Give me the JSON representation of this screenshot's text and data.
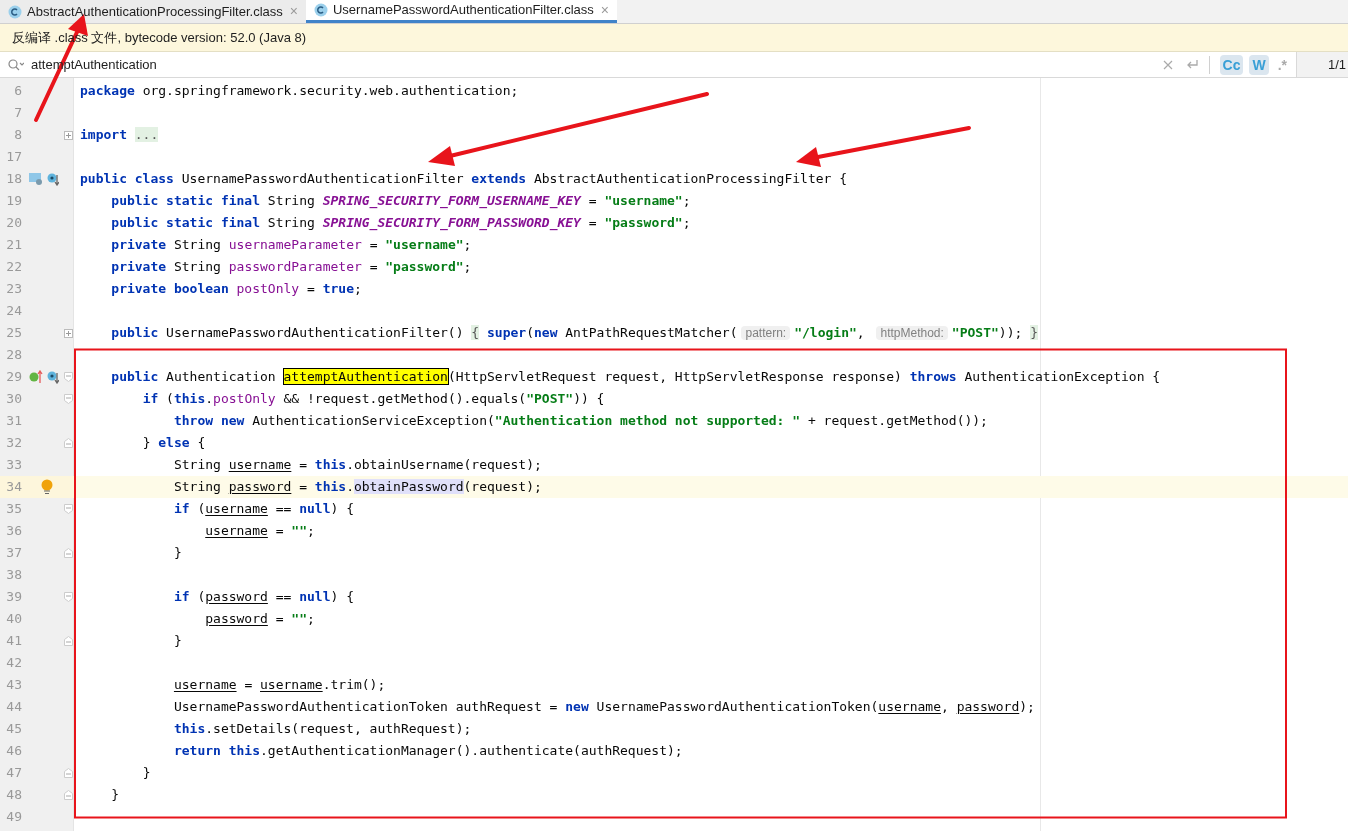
{
  "tabs": [
    {
      "label": "AbstractAuthenticationProcessingFilter.class",
      "close": "×",
      "selected": false
    },
    {
      "label": "UsernamePasswordAuthenticationFilter.class",
      "close": "×",
      "selected": true
    }
  ],
  "banner": {
    "text": "反编译 .class 文件, bytecode version: 52.0 (Java 8)"
  },
  "search": {
    "value": "attemptAuthentication",
    "options": [
      {
        "label": "Cc",
        "on": true
      },
      {
        "label": "W",
        "on": true
      },
      {
        "label": ".*",
        "on": false
      }
    ],
    "count": "1/1"
  },
  "editor": {
    "lines": [
      {
        "number": "6",
        "current": false,
        "tokens": [
          {
            "kind": "kw",
            "text": "package"
          },
          {
            "kind": "text",
            "text": " org.springframework.security.web.authentication;"
          }
        ]
      },
      {
        "number": "7",
        "current": false
      },
      {
        "number": "8",
        "current": false,
        "fold_marker": {
          "kind": "expand"
        },
        "tokens": [
          {
            "kind": "kw",
            "text": "import "
          },
          {
            "kind": "folded",
            "text": "..."
          }
        ]
      },
      {
        "number": "17",
        "current": false
      },
      {
        "number": "18",
        "current": false,
        "gutter": [
          {
            "kind": "implemented"
          },
          {
            "kind": "overridden"
          }
        ],
        "tokens": [
          {
            "kind": "kw",
            "text": "public class"
          },
          {
            "kind": "text",
            "text": " UsernamePasswordAuthenticationFilter "
          },
          {
            "kind": "kw",
            "text": "extends"
          },
          {
            "kind": "text",
            "text": " AbstractAuthenticationProcessingFilter {"
          }
        ]
      },
      {
        "number": "19",
        "current": false,
        "tokens": [
          {
            "kind": "kw",
            "text": "    public static final"
          },
          {
            "kind": "text",
            "text": " String "
          },
          {
            "kind": "const",
            "text": "SPRING_SECURITY_FORM_USERNAME_KEY"
          },
          {
            "kind": "text",
            "text": " = "
          },
          {
            "kind": "str",
            "text": "\"username\""
          },
          {
            "kind": "text",
            "text": ";"
          }
        ]
      },
      {
        "number": "20",
        "current": false,
        "tokens": [
          {
            "kind": "kw",
            "text": "    public static final"
          },
          {
            "kind": "text",
            "text": " String "
          },
          {
            "kind": "const",
            "text": "SPRING_SECURITY_FORM_PASSWORD_KEY"
          },
          {
            "kind": "text",
            "text": " = "
          },
          {
            "kind": "str",
            "text": "\"password\""
          },
          {
            "kind": "text",
            "text": ";"
          }
        ]
      },
      {
        "number": "21",
        "current": false,
        "tokens": [
          {
            "kind": "kw",
            "text": "    private"
          },
          {
            "kind": "text",
            "text": " String "
          },
          {
            "kind": "field",
            "text": "usernameParameter"
          },
          {
            "kind": "text",
            "text": " = "
          },
          {
            "kind": "str",
            "text": "\"username\""
          },
          {
            "kind": "text",
            "text": ";"
          }
        ]
      },
      {
        "number": "22",
        "current": false,
        "tokens": [
          {
            "kind": "kw",
            "text": "    private"
          },
          {
            "kind": "text",
            "text": " String "
          },
          {
            "kind": "field",
            "text": "passwordParameter"
          },
          {
            "kind": "text",
            "text": " = "
          },
          {
            "kind": "str",
            "text": "\"password\""
          },
          {
            "kind": "text",
            "text": ";"
          }
        ]
      },
      {
        "number": "23",
        "current": false,
        "tokens": [
          {
            "kind": "kw",
            "text": "    private boolean "
          },
          {
            "kind": "field",
            "text": "postOnly"
          },
          {
            "kind": "text",
            "text": " = "
          },
          {
            "kind": "kw",
            "text": "true"
          },
          {
            "kind": "text",
            "text": ";"
          }
        ]
      },
      {
        "number": "24",
        "current": false
      },
      {
        "number": "25",
        "current": false,
        "fold_marker": {
          "kind": "expand"
        },
        "tokens": [
          {
            "kind": "kw",
            "text": "    public"
          },
          {
            "kind": "text",
            "text": " UsernamePasswordAuthenticationFilter() "
          },
          {
            "kind": "folded",
            "text": "{"
          },
          {
            "kind": "kw",
            "text": " super"
          },
          {
            "kind": "text",
            "text": "("
          },
          {
            "kind": "kw",
            "text": "new"
          },
          {
            "kind": "text",
            "text": " AntPathRequestMatcher("
          },
          {
            "kind": "hint",
            "text": "pattern:"
          },
          {
            "kind": "str",
            "text": "\"/login\""
          },
          {
            "kind": "text",
            "text": ", "
          },
          {
            "kind": "hint",
            "text": "httpMethod:"
          },
          {
            "kind": "str",
            "text": "\"POST\""
          },
          {
            "kind": "text",
            "text": ")); "
          },
          {
            "kind": "folded",
            "text": "}"
          }
        ]
      },
      {
        "number": "28",
        "current": false
      },
      {
        "number": "29",
        "current": false,
        "gutter": [
          {
            "kind": "implements"
          },
          {
            "kind": "overridden"
          }
        ],
        "fold_marker": {
          "kind": "start"
        },
        "tokens": [
          {
            "kind": "kw",
            "text": "    public"
          },
          {
            "kind": "text",
            "text": " Authentication "
          },
          {
            "kind": "match",
            "text": "attemptAuthentication"
          },
          {
            "kind": "text",
            "text": "(HttpServletRequest request, HttpServletResponse response) "
          },
          {
            "kind": "kw",
            "text": "throws"
          },
          {
            "kind": "text",
            "text": " AuthenticationException {"
          }
        ]
      },
      {
        "number": "30",
        "current": false,
        "fold_marker": {
          "kind": "start"
        },
        "tokens": [
          {
            "kind": "kw",
            "text": "        if"
          },
          {
            "kind": "text",
            "text": " ("
          },
          {
            "kind": "kw",
            "text": "this"
          },
          {
            "kind": "text",
            "text": "."
          },
          {
            "kind": "field",
            "text": "postOnly"
          },
          {
            "kind": "text",
            "text": " && !request.getMethod().equals("
          },
          {
            "kind": "str",
            "text": "\"POST\""
          },
          {
            "kind": "text",
            "text": ")) {"
          }
        ]
      },
      {
        "number": "31",
        "current": false,
        "tokens": [
          {
            "kind": "kw",
            "text": "            throw new"
          },
          {
            "kind": "text",
            "text": " AuthenticationServiceException("
          },
          {
            "kind": "str",
            "text": "\"Authentication method not supported: \""
          },
          {
            "kind": "text",
            "text": " + request.getMethod());"
          }
        ]
      },
      {
        "number": "32",
        "current": false,
        "fold_marker": {
          "kind": "end"
        },
        "tokens": [
          {
            "kind": "text",
            "text": "        } "
          },
          {
            "kind": "kw",
            "text": "else"
          },
          {
            "kind": "text",
            "text": " {"
          }
        ]
      },
      {
        "number": "33",
        "current": false,
        "tokens": [
          {
            "kind": "text",
            "text": "            String "
          },
          {
            "kind": "var",
            "text": "username"
          },
          {
            "kind": "text",
            "text": " = "
          },
          {
            "kind": "kw",
            "text": "this"
          },
          {
            "kind": "text",
            "text": ".obtainUsername(request);"
          }
        ]
      },
      {
        "number": "34",
        "current": true,
        "gutter": [
          {
            "kind": "bulb"
          }
        ],
        "tokens": [
          {
            "kind": "text",
            "text": "            String "
          },
          {
            "kind": "var",
            "text": "password"
          },
          {
            "kind": "text",
            "text": " = "
          },
          {
            "kind": "kw",
            "text": "this"
          },
          {
            "kind": "text",
            "text": "."
          },
          {
            "kind": "usage",
            "text": "obtainPassword"
          },
          {
            "kind": "text",
            "text": "(request);"
          }
        ]
      },
      {
        "number": "35",
        "current": false,
        "fold_marker": {
          "kind": "start"
        },
        "tokens": [
          {
            "kind": "kw",
            "text": "            if"
          },
          {
            "kind": "text",
            "text": " ("
          },
          {
            "kind": "var",
            "text": "username"
          },
          {
            "kind": "text",
            "text": " == "
          },
          {
            "kind": "kw",
            "text": "null"
          },
          {
            "kind": "text",
            "text": ") {"
          }
        ]
      },
      {
        "number": "36",
        "current": false,
        "tokens": [
          {
            "kind": "var",
            "text": "                username"
          },
          {
            "kind": "text",
            "text": " = "
          },
          {
            "kind": "str",
            "text": "\"\""
          },
          {
            "kind": "text",
            "text": ";"
          }
        ]
      },
      {
        "number": "37",
        "current": false,
        "fold_marker": {
          "kind": "end"
        },
        "tokens": [
          {
            "kind": "text",
            "text": "            }"
          }
        ]
      },
      {
        "number": "38",
        "current": false
      },
      {
        "number": "39",
        "current": false,
        "fold_marker": {
          "kind": "start"
        },
        "tokens": [
          {
            "kind": "kw",
            "text": "            if"
          },
          {
            "kind": "text",
            "text": " ("
          },
          {
            "kind": "var",
            "text": "password"
          },
          {
            "kind": "text",
            "text": " == "
          },
          {
            "kind": "kw",
            "text": "null"
          },
          {
            "kind": "text",
            "text": ") {"
          }
        ]
      },
      {
        "number": "40",
        "current": false,
        "tokens": [
          {
            "kind": "var",
            "text": "                password"
          },
          {
            "kind": "text",
            "text": " = "
          },
          {
            "kind": "str",
            "text": "\"\""
          },
          {
            "kind": "text",
            "text": ";"
          }
        ]
      },
      {
        "number": "41",
        "current": false,
        "fold_marker": {
          "kind": "end"
        },
        "tokens": [
          {
            "kind": "text",
            "text": "            }"
          }
        ]
      },
      {
        "number": "42",
        "current": false
      },
      {
        "number": "43",
        "current": false,
        "tokens": [
          {
            "kind": "var",
            "text": "            username"
          },
          {
            "kind": "text",
            "text": " = "
          },
          {
            "kind": "var",
            "text": "username"
          },
          {
            "kind": "text",
            "text": ".trim();"
          }
        ]
      },
      {
        "number": "44",
        "current": false,
        "tokens": [
          {
            "kind": "text",
            "text": "            UsernamePasswordAuthenticationToken authRequest = "
          },
          {
            "kind": "kw",
            "text": "new"
          },
          {
            "kind": "text",
            "text": " UsernamePasswordAuthenticationToken("
          },
          {
            "kind": "var",
            "text": "username"
          },
          {
            "kind": "text",
            "text": ", "
          },
          {
            "kind": "var",
            "text": "password"
          },
          {
            "kind": "text",
            "text": ");"
          }
        ]
      },
      {
        "number": "45",
        "current": false,
        "tokens": [
          {
            "kind": "kw",
            "text": "            this"
          },
          {
            "kind": "text",
            "text": ".setDetails(request, authRequest);"
          }
        ]
      },
      {
        "number": "46",
        "current": false,
        "tokens": [
          {
            "kind": "kw",
            "text": "            return this"
          },
          {
            "kind": "text",
            "text": ".getAuthenticationManager().authenticate(authRequest);"
          }
        ]
      },
      {
        "number": "47",
        "current": false,
        "fold_marker": {
          "kind": "end"
        },
        "tokens": [
          {
            "kind": "text",
            "text": "        }"
          }
        ]
      },
      {
        "number": "48",
        "current": false,
        "fold_marker": {
          "kind": "end"
        },
        "tokens": [
          {
            "kind": "text",
            "text": "    }"
          }
        ]
      },
      {
        "number": "49",
        "current": false
      }
    ]
  }
}
